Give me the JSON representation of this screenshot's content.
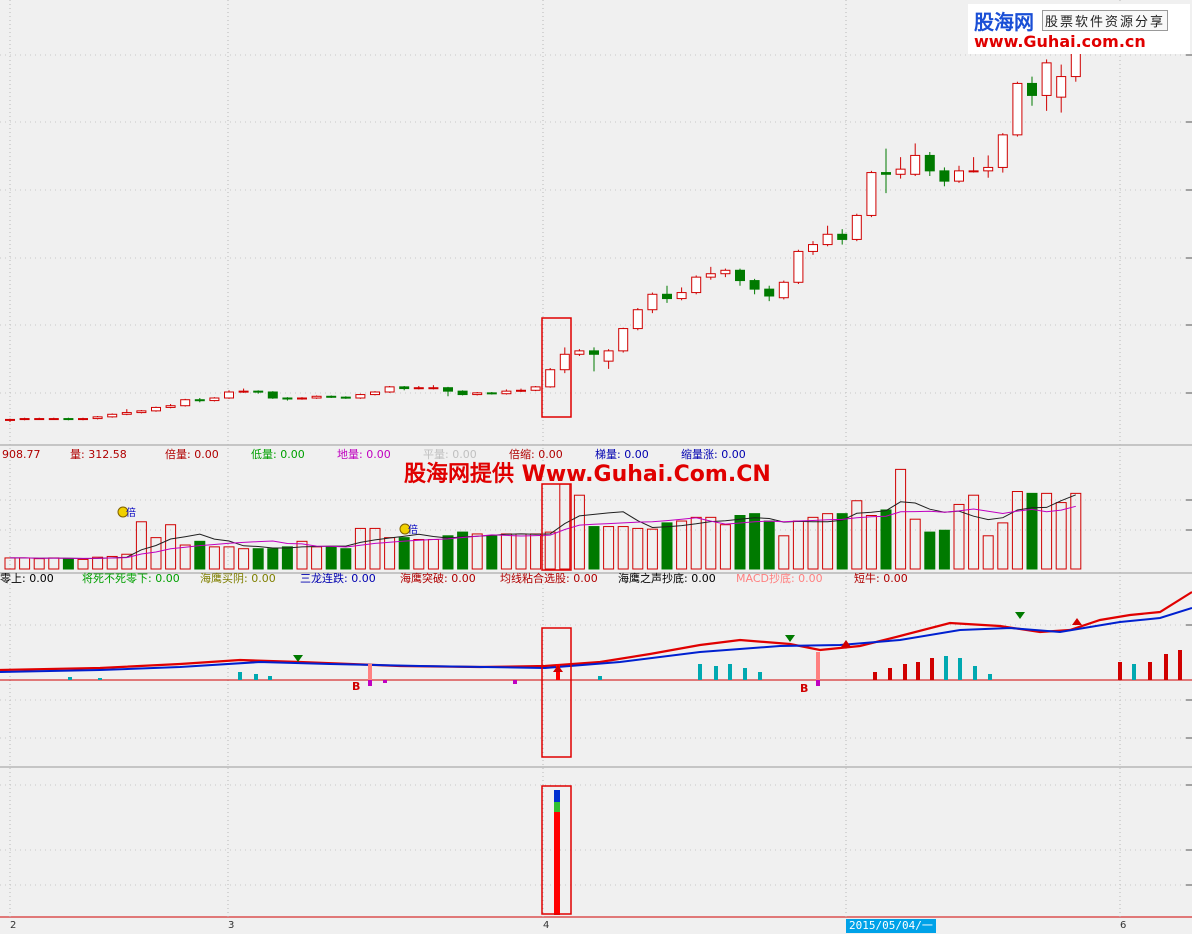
{
  "watermarks": {
    "logo_cn": "股海网",
    "logo_tagline": "股票软件资源分享",
    "logo_url": "www.Guhai.com.cn",
    "center_text": "股海网提供 Www.Guhai.Com.CN"
  },
  "x_axis": {
    "labels": [
      "2",
      "3",
      "4",
      "6"
    ],
    "current_date": "2015/05/04/一"
  },
  "volume_panel": {
    "header": [
      {
        "text": "908.77",
        "color": "#b00000"
      },
      {
        "text": "量: 312.58",
        "color": "#b00000"
      },
      {
        "text": "倍量: 0.00",
        "color": "#b00000"
      },
      {
        "text": "低量: 0.00",
        "color": "#00a000"
      },
      {
        "text": "地量: 0.00",
        "color": "#c000c0"
      },
      {
        "text": "平量: 0.00",
        "color": "#c0c0c0"
      },
      {
        "text": "倍缩: 0.00",
        "color": "#b00000"
      },
      {
        "text": "梯量: 0.00",
        "color": "#0000b0"
      },
      {
        "text": "缩量涨: 0.00",
        "color": "#0000b0"
      }
    ],
    "marker_label": "倍"
  },
  "indicator_panel": {
    "header": [
      {
        "text": "零上: 0.00",
        "color": "#000000"
      },
      {
        "text": "将死不死零下: 0.00",
        "color": "#00a000"
      },
      {
        "text": "海鹰买阴: 0.00",
        "color": "#808000"
      },
      {
        "text": "三龙连跌: 0.00",
        "color": "#0000b0"
      },
      {
        "text": "海鹰突破: 0.00",
        "color": "#b00000"
      },
      {
        "text": "均线粘合选股: 0.00",
        "color": "#b00000"
      },
      {
        "text": "海鹰之声抄底: 0.00",
        "color": "#000000"
      },
      {
        "text": "MACD抄底: 0.00",
        "color": "#ff8080"
      },
      {
        "text": "短牛: 0.00",
        "color": "#b00000"
      }
    ],
    "buy_marker": "B"
  },
  "chart_data": {
    "type": "candlestick",
    "candles": [
      {
        "o": 3,
        "c": 4,
        "h": 5,
        "l": 1
      },
      {
        "o": 4,
        "c": 5,
        "h": 6,
        "l": 3
      },
      {
        "o": 5,
        "c": 5,
        "h": 6,
        "l": 4
      },
      {
        "o": 5,
        "c": 5,
        "h": 6,
        "l": 4
      },
      {
        "o": 5,
        "c": 4,
        "h": 6,
        "l": 3
      },
      {
        "o": 4,
        "c": 5,
        "h": 6,
        "l": 3
      },
      {
        "o": 5,
        "c": 7,
        "h": 8,
        "l": 4
      },
      {
        "o": 7,
        "c": 10,
        "h": 11,
        "l": 6
      },
      {
        "o": 10,
        "c": 12,
        "h": 16,
        "l": 9
      },
      {
        "o": 12,
        "c": 14,
        "h": 15,
        "l": 11
      },
      {
        "o": 14,
        "c": 18,
        "h": 19,
        "l": 13
      },
      {
        "o": 18,
        "c": 20,
        "h": 22,
        "l": 17
      },
      {
        "o": 20,
        "c": 27,
        "h": 28,
        "l": 19
      },
      {
        "o": 27,
        "c": 26,
        "h": 29,
        "l": 24
      },
      {
        "o": 26,
        "c": 29,
        "h": 30,
        "l": 25
      },
      {
        "o": 29,
        "c": 36,
        "h": 38,
        "l": 28
      },
      {
        "o": 36,
        "c": 37,
        "h": 40,
        "l": 35
      },
      {
        "o": 37,
        "c": 36,
        "h": 38,
        "l": 34
      },
      {
        "o": 36,
        "c": 29,
        "h": 37,
        "l": 28
      },
      {
        "o": 29,
        "c": 28,
        "h": 30,
        "l": 26
      },
      {
        "o": 28,
        "c": 29,
        "h": 30,
        "l": 27
      },
      {
        "o": 29,
        "c": 31,
        "h": 32,
        "l": 28
      },
      {
        "o": 31,
        "c": 30,
        "h": 32,
        "l": 29
      },
      {
        "o": 30,
        "c": 29,
        "h": 31,
        "l": 28
      },
      {
        "o": 29,
        "c": 33,
        "h": 34,
        "l": 28
      },
      {
        "o": 33,
        "c": 36,
        "h": 37,
        "l": 32
      },
      {
        "o": 36,
        "c": 42,
        "h": 43,
        "l": 35
      },
      {
        "o": 42,
        "c": 40,
        "h": 43,
        "l": 38
      },
      {
        "o": 40,
        "c": 41,
        "h": 43,
        "l": 39
      },
      {
        "o": 41,
        "c": 41,
        "h": 44,
        "l": 39
      },
      {
        "o": 41,
        "c": 37,
        "h": 42,
        "l": 31
      },
      {
        "o": 37,
        "c": 33,
        "h": 38,
        "l": 32
      },
      {
        "o": 33,
        "c": 35,
        "h": 36,
        "l": 32
      },
      {
        "o": 35,
        "c": 34,
        "h": 36,
        "l": 33
      },
      {
        "o": 34,
        "c": 37,
        "h": 39,
        "l": 33
      },
      {
        "o": 37,
        "c": 38,
        "h": 40,
        "l": 36
      },
      {
        "o": 38,
        "c": 42,
        "h": 43,
        "l": 37
      },
      {
        "o": 42,
        "c": 62,
        "h": 64,
        "l": 41
      },
      {
        "o": 62,
        "c": 80,
        "h": 88,
        "l": 58
      },
      {
        "o": 80,
        "c": 84,
        "h": 86,
        "l": 78
      },
      {
        "o": 84,
        "c": 80,
        "h": 88,
        "l": 60
      },
      {
        "o": 72,
        "c": 84,
        "h": 86,
        "l": 63
      },
      {
        "o": 84,
        "c": 110,
        "h": 111,
        "l": 82
      },
      {
        "o": 110,
        "c": 132,
        "h": 134,
        "l": 108
      },
      {
        "o": 132,
        "c": 150,
        "h": 152,
        "l": 128
      },
      {
        "o": 150,
        "c": 145,
        "h": 160,
        "l": 140
      },
      {
        "o": 145,
        "c": 152,
        "h": 158,
        "l": 143
      },
      {
        "o": 152,
        "c": 170,
        "h": 172,
        "l": 150
      },
      {
        "o": 170,
        "c": 174,
        "h": 182,
        "l": 167
      },
      {
        "o": 174,
        "c": 178,
        "h": 180,
        "l": 170
      },
      {
        "o": 178,
        "c": 166,
        "h": 180,
        "l": 160
      },
      {
        "o": 166,
        "c": 156,
        "h": 168,
        "l": 150
      },
      {
        "o": 156,
        "c": 148,
        "h": 160,
        "l": 142
      },
      {
        "o": 146,
        "c": 164,
        "h": 166,
        "l": 144
      },
      {
        "o": 164,
        "c": 200,
        "h": 202,
        "l": 162
      },
      {
        "o": 200,
        "c": 208,
        "h": 212,
        "l": 196
      },
      {
        "o": 208,
        "c": 220,
        "h": 230,
        "l": 206
      },
      {
        "o": 220,
        "c": 214,
        "h": 226,
        "l": 208
      },
      {
        "o": 214,
        "c": 242,
        "h": 244,
        "l": 212
      },
      {
        "o": 242,
        "c": 292,
        "h": 294,
        "l": 240
      },
      {
        "o": 292,
        "c": 290,
        "h": 320,
        "l": 268
      },
      {
        "o": 290,
        "c": 296,
        "h": 310,
        "l": 285
      },
      {
        "o": 290,
        "c": 312,
        "h": 326,
        "l": 288
      },
      {
        "o": 312,
        "c": 294,
        "h": 316,
        "l": 288
      },
      {
        "o": 294,
        "c": 282,
        "h": 298,
        "l": 276
      },
      {
        "o": 282,
        "c": 294,
        "h": 300,
        "l": 280
      },
      {
        "o": 294,
        "c": 294,
        "h": 310,
        "l": 292
      },
      {
        "o": 294,
        "c": 298,
        "h": 312,
        "l": 286
      },
      {
        "o": 298,
        "c": 336,
        "h": 338,
        "l": 292
      },
      {
        "o": 336,
        "c": 396,
        "h": 398,
        "l": 334
      },
      {
        "o": 396,
        "c": 382,
        "h": 404,
        "l": 370
      },
      {
        "o": 382,
        "c": 420,
        "h": 424,
        "l": 364
      },
      {
        "o": 380,
        "c": 404,
        "h": 418,
        "l": 362
      },
      {
        "o": 404,
        "c": 456,
        "h": 470,
        "l": 398
      }
    ],
    "volume": [
      30,
      30,
      28,
      30,
      28,
      26,
      32,
      34,
      40,
      128,
      85,
      120,
      65,
      75,
      60,
      60,
      55,
      55,
      55,
      60,
      75,
      60,
      60,
      55,
      110,
      110,
      85,
      85,
      80,
      80,
      90,
      100,
      95,
      90,
      95,
      95,
      95,
      100,
      230,
      200,
      115,
      115,
      115,
      110,
      108,
      125,
      130,
      140,
      140,
      120,
      145,
      150,
      130,
      90,
      130,
      140,
      150,
      150,
      185,
      145,
      160,
      270,
      135,
      100,
      105,
      175,
      200,
      90,
      125,
      210,
      205,
      205,
      180,
      205
    ]
  }
}
